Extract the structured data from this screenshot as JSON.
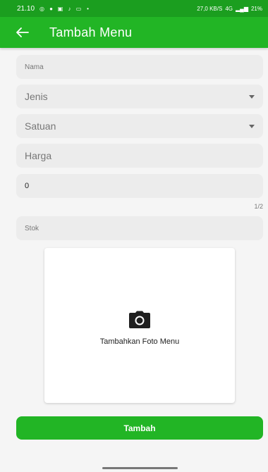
{
  "status_bar": {
    "time": "21.10",
    "speed": "27,0 KB/S",
    "network": "4G",
    "battery": "21%"
  },
  "app_bar": {
    "title": "Tambah Menu",
    "back_icon": "arrow-back-icon"
  },
  "form": {
    "nama": {
      "placeholder": "Nama"
    },
    "jenis": {
      "placeholder": "Jenis"
    },
    "satuan": {
      "placeholder": "Satuan"
    },
    "harga": {
      "placeholder": "Harga"
    },
    "jumlah": {
      "value": "0",
      "counter": "1/2"
    },
    "stok": {
      "placeholder": "Stok"
    }
  },
  "photo": {
    "icon": "camera-icon",
    "label": "Tambahkan Foto Menu"
  },
  "submit": {
    "label": "Tambah"
  },
  "colors": {
    "primary": "#22b525",
    "status_bar": "#1b9e1f",
    "field_bg": "#ececec",
    "background": "#f5f5f5"
  }
}
